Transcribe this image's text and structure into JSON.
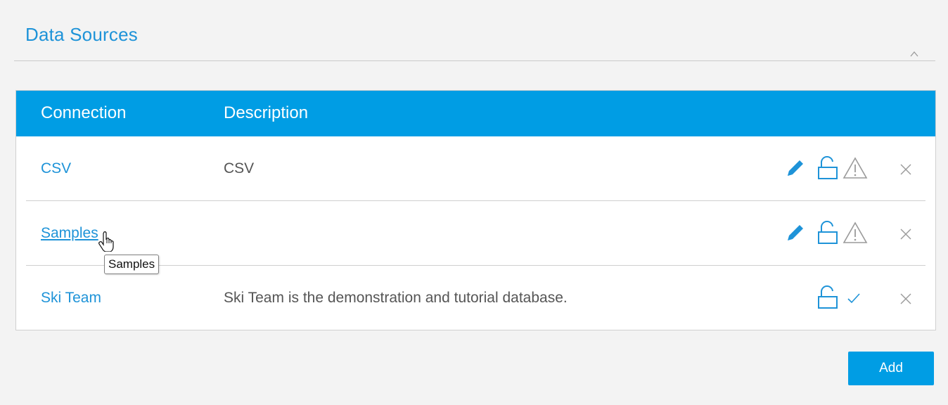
{
  "panel": {
    "title": "Data Sources",
    "collapse_icon": "chevron-up-icon"
  },
  "table": {
    "columns": [
      "Connection",
      "Description"
    ],
    "rows": [
      {
        "connection": "CSV",
        "description": "CSV",
        "actions": [
          "pencil-icon",
          "unlock-icon",
          "warning-icon",
          "close-icon"
        ]
      },
      {
        "connection": "Samples",
        "description": "",
        "actions": [
          "pencil-icon",
          "unlock-icon",
          "warning-icon",
          "close-icon"
        ]
      },
      {
        "connection": "Ski Team",
        "description": "Ski Team is the demonstration and tutorial database.",
        "actions": [
          "unlock-icon",
          "check-icon",
          "close-icon"
        ]
      }
    ]
  },
  "tooltip": {
    "text": "Samples"
  },
  "buttons": {
    "add_label": "Add"
  },
  "colors": {
    "accent": "#009de4",
    "link": "#1e93d8",
    "icon_gray": "#999999"
  }
}
